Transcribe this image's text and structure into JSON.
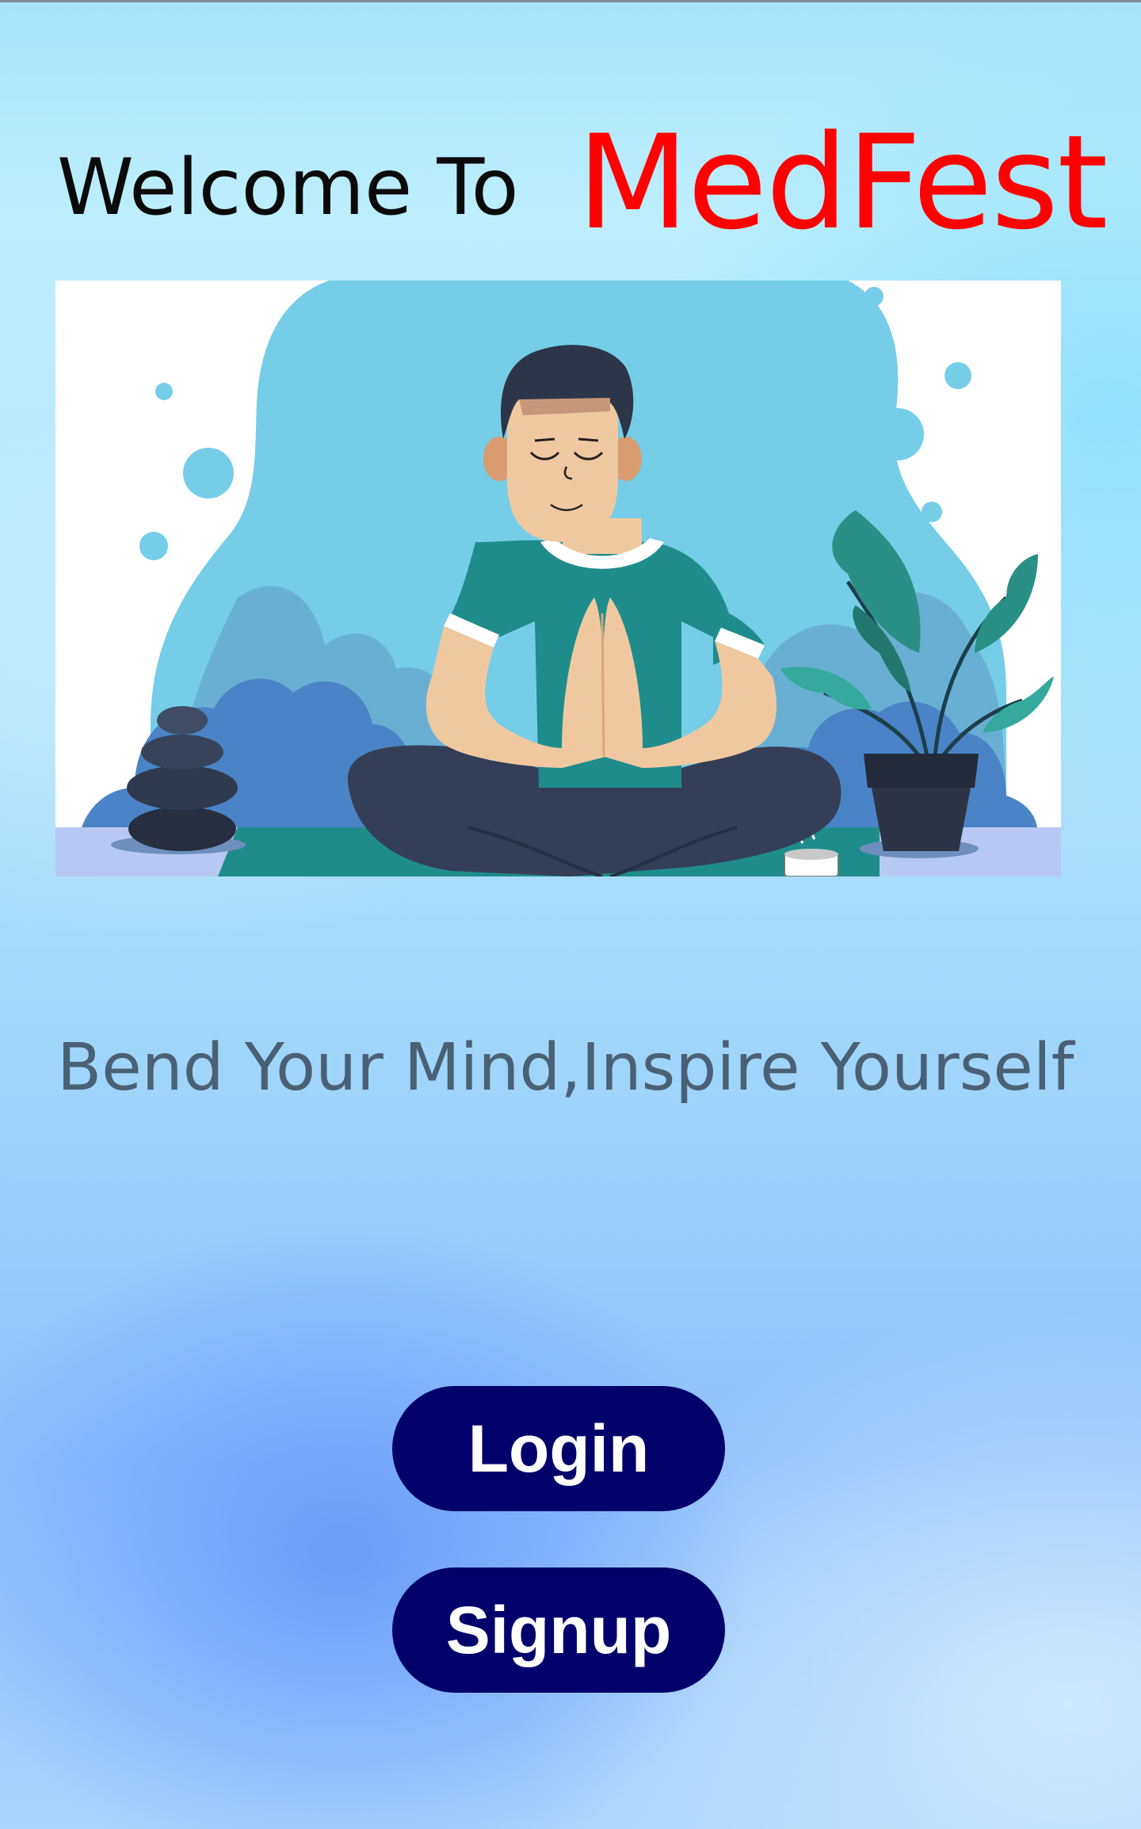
{
  "header": {
    "welcome_text": "Welcome To",
    "brand_name": "MedFest"
  },
  "hero": {
    "illustration": "meditating-person-illustration"
  },
  "tagline": "Bend Your Mind,Inspire Yourself",
  "actions": {
    "login_label": "Login",
    "signup_label": "Signup"
  },
  "colors": {
    "brand": "#ff0000",
    "button_bg": "#02006b",
    "button_text": "#ffffff",
    "tagline": "#4a6175"
  }
}
